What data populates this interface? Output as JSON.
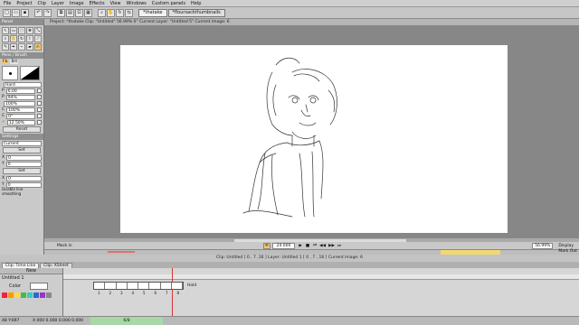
{
  "menu": [
    "File",
    "Project",
    "Clip",
    "Layer",
    "Image",
    "Effects",
    "View",
    "Windows",
    "Custom panels",
    "Help"
  ],
  "doc_tabs": [
    "*thatake",
    "*floursackthumbnails"
  ],
  "info_bar": "Project: *thatake  Clip: \"Untitled\"  56.99%  0°  Current Layer: \"Untitled 5\"  Current image: 6",
  "left_panel": {
    "title_tools": "Panel",
    "title_brush": "Pens / Brush",
    "brush_tab_a": "Fb",
    "brush_tab_b": "Brt",
    "props": [
      {
        "label": "",
        "value": "Hard"
      },
      {
        "label": "P",
        "value": "6.00"
      },
      {
        "label": "P",
        "value": "94%"
      },
      {
        "label": "",
        "value": "100%"
      },
      {
        "label": "C",
        "value": "100%"
      },
      {
        "label": "C",
        "value": "0°"
      },
      {
        "label": "",
        "value": "12.50%"
      }
    ],
    "reset_label": "Reset",
    "layer_title": "Settings",
    "layer_mode": "Current",
    "set_label_1": "Set",
    "field_x": "0",
    "field_y": "0",
    "set_label_2": "Set",
    "field_x2": "0",
    "field_y2": "0",
    "footer": "Disable line smoothing"
  },
  "playbar": {
    "mark_in": "Mark in",
    "zoom_value": "24.000",
    "zoom_pct": "56.99%",
    "display_label": "Display",
    "mark_out": "Mark Out"
  },
  "clip_status": "Clip: Untitled [ 0 , 7 ,16 ]    Layer: Untitled 1 [ 0 , 7 , 16 ]    Current image: 6",
  "timeline_tabs": [
    "Clip: Time Line",
    "Clip: XSheet"
  ],
  "timeline": {
    "new_label": "New",
    "layer_name": "Untitled 1",
    "color_label": "Color",
    "hold_label": "Hold",
    "frame_numbers": [
      "1",
      "2",
      "3",
      "4",
      "5",
      "6",
      "7",
      "8"
    ]
  },
  "bottom": {
    "left": "48 Y:697",
    "coords": "X 000 0.000 0.000 0.000",
    "page": "6/8"
  }
}
